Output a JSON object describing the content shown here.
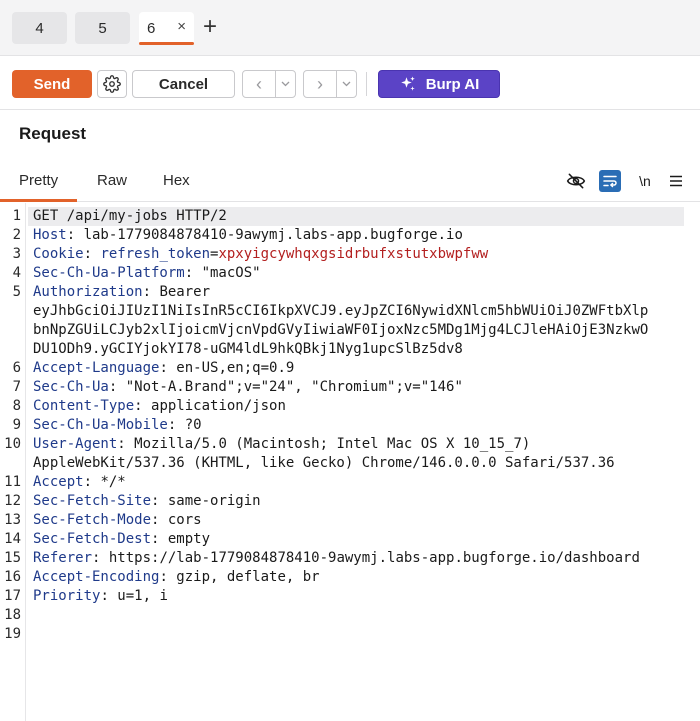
{
  "tabs": [
    {
      "label": "4"
    },
    {
      "label": "5"
    },
    {
      "label": "6",
      "close": "×"
    }
  ],
  "add_tab_label": "+",
  "toolbar": {
    "send_label": "Send",
    "cancel_label": "Cancel",
    "back_arrow": "‹",
    "forward_arrow": "›",
    "dropdown": "⌄",
    "ai_label": "Burp AI"
  },
  "colors": {
    "accent": "#e2622a",
    "ai_purple": "#5b43c6",
    "header_key": "#1f3a8a",
    "cookie_value": "#b32020",
    "wrap_active": "#2a6db5"
  },
  "request": {
    "title": "Request",
    "subtabs": [
      {
        "label": "Pretty"
      },
      {
        "label": "Raw"
      },
      {
        "label": "Hex"
      }
    ],
    "newline_toggle": "\\n",
    "icons": [
      "eye-slash-icon",
      "wrap-icon",
      "newline-toggle",
      "menu-icon"
    ]
  },
  "editor": {
    "lines": [
      {
        "num": "1",
        "text": "GET /api/my-jobs HTTP/2"
      },
      {
        "num": "2",
        "key": "Host",
        "sep": ": ",
        "text": "lab-1779084878410-9awymj.labs-app.bugforge.io"
      },
      {
        "num": "3",
        "key": "Cookie",
        "sep": ": ",
        "ckey": "refresh_token",
        "ceq": "=",
        "cval": "xpxyigcywhqxgsidrbufxstutxbwpfww"
      },
      {
        "num": "4",
        "key": "Sec-Ch-Ua-Platform",
        "sep": ": ",
        "text": "\"macOS\""
      },
      {
        "num": "5",
        "key": "Authorization",
        "sep": ": ",
        "text": "Bearer"
      },
      {
        "num": "",
        "text": "eyJhbGciOiJIUzI1NiIsInR5cCI6IkpXVCJ9.eyJpZCI6NywidXNlcm5hbWUiOiJ0ZWFtbXlp"
      },
      {
        "num": "",
        "text": "bnNpZGUiLCJyb2xlIjoicmVjcnVpdGVyIiwiaWF0IjoxNzc5MDg1Mjg4LCJleHAiOjE3NzkwO"
      },
      {
        "num": "",
        "text": "DU1ODh9.yGCIYjokYI78-uGM4ldL9hkQBkj1Nyg1upcSlBz5dv8"
      },
      {
        "num": "6",
        "key": "Accept-Language",
        "sep": ": ",
        "text": "en-US,en;q=0.9"
      },
      {
        "num": "7",
        "key": "Sec-Ch-Ua",
        "sep": ": ",
        "text": "\"Not-A.Brand\";v=\"24\", \"Chromium\";v=\"146\""
      },
      {
        "num": "8",
        "key": "Content-Type",
        "sep": ": ",
        "text": "application/json"
      },
      {
        "num": "9",
        "key": "Sec-Ch-Ua-Mobile",
        "sep": ": ",
        "text": "?0"
      },
      {
        "num": "10",
        "key": "User-Agent",
        "sep": ": ",
        "text": "Mozilla/5.0 (Macintosh; Intel Mac OS X 10_15_7)"
      },
      {
        "num": "",
        "text": "AppleWebKit/537.36 (KHTML, like Gecko) Chrome/146.0.0.0 Safari/537.36"
      },
      {
        "num": "11",
        "key": "Accept",
        "sep": ": ",
        "text": "*/*"
      },
      {
        "num": "12",
        "key": "Sec-Fetch-Site",
        "sep": ": ",
        "text": "same-origin"
      },
      {
        "num": "13",
        "key": "Sec-Fetch-Mode",
        "sep": ": ",
        "text": "cors"
      },
      {
        "num": "14",
        "key": "Sec-Fetch-Dest",
        "sep": ": ",
        "text": "empty"
      },
      {
        "num": "15",
        "key": "Referer",
        "sep": ": ",
        "text": "https://lab-1779084878410-9awymj.labs-app.bugforge.io/dashboard"
      },
      {
        "num": "16",
        "key": "Accept-Encoding",
        "sep": ": ",
        "text": "gzip, deflate, br"
      },
      {
        "num": "17",
        "key": "Priority",
        "sep": ": ",
        "text": "u=1, i"
      },
      {
        "num": "18",
        "text": ""
      },
      {
        "num": "19",
        "text": ""
      }
    ]
  }
}
